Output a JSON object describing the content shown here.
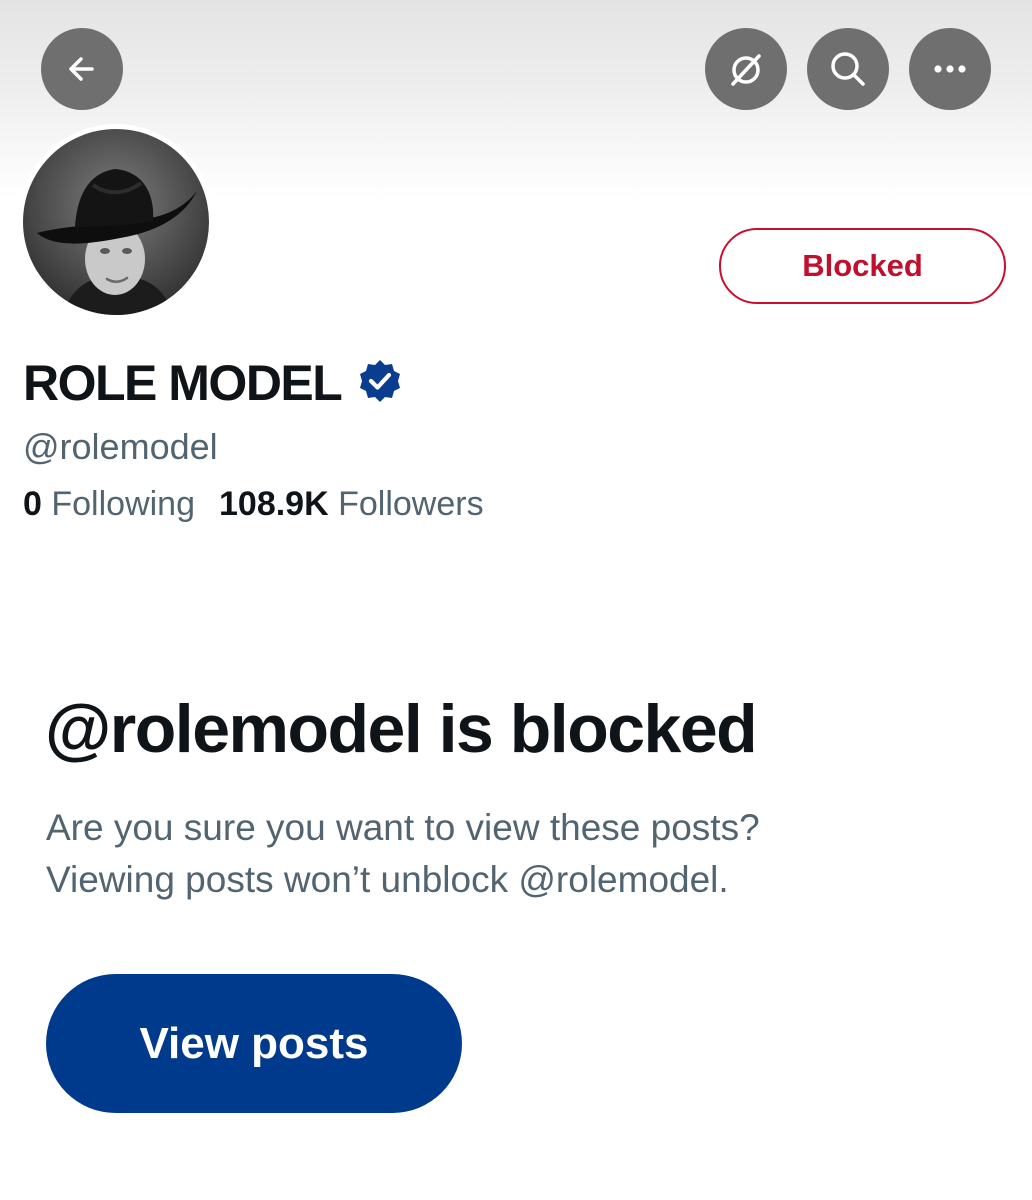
{
  "header": {
    "buttons": [
      {
        "name": "back",
        "icon": "arrow-left-icon"
      },
      {
        "name": "grok",
        "icon": "slashed-circle-icon"
      },
      {
        "name": "search",
        "icon": "search-icon"
      },
      {
        "name": "more",
        "icon": "more-dots-icon"
      }
    ]
  },
  "profile": {
    "display_name": "ROLE MODEL",
    "verified": true,
    "handle": "@rolemodel",
    "following_count": "0",
    "following_label": "Following",
    "followers_count": "108.9K",
    "followers_label": "Followers",
    "blocked_button_label": "Blocked"
  },
  "blocked_notice": {
    "title": "@rolemodel is blocked",
    "message_line1": "Are you sure you want to view these posts?",
    "message_line2": "Viewing posts won’t unblock @rolemodel.",
    "view_posts_label": "View posts"
  },
  "colors": {
    "header_button_bg": "#6f6f6f",
    "blocked_red": "#c8102e",
    "verified_badge": "#0a3d8f",
    "view_posts_bg": "#003a8c",
    "secondary_text": "#536471"
  }
}
